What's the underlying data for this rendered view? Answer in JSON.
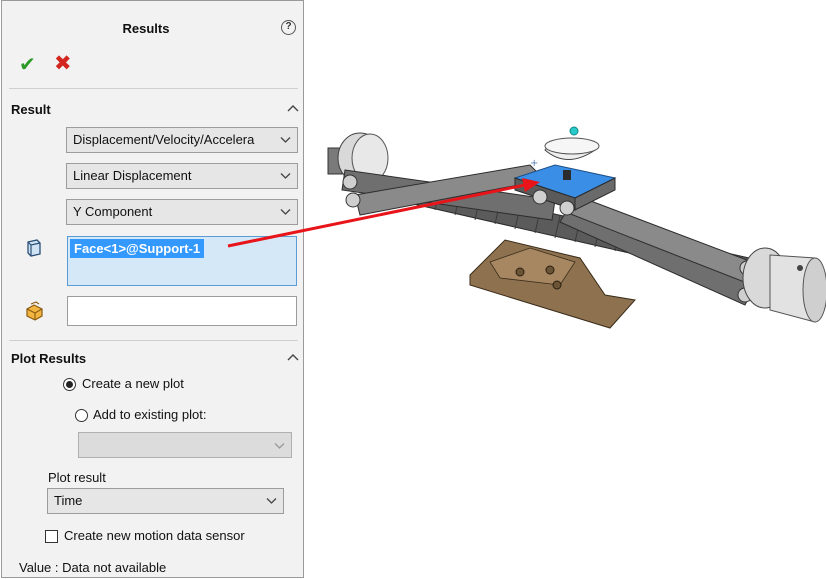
{
  "panel": {
    "title": "Results",
    "help_icon": "help-icon",
    "ok_icon": "checkmark-icon",
    "cancel_icon": "close-icon",
    "ok_symbol": "✔",
    "cancel_symbol": "✖",
    "help_symbol": "?"
  },
  "result_section": {
    "title": "Result",
    "category": "Displacement/Velocity/Accelera",
    "subcategory": "Linear Displacement",
    "component": "Y Component",
    "selection_item": "Face<1>@Support-1",
    "secondary_value": ""
  },
  "plot_section": {
    "title": "Plot Results",
    "option_new": "Create a new plot",
    "option_existing": "Add to existing plot:",
    "selected_option": "new",
    "existing_plot_value": "",
    "plot_result_label": "Plot result",
    "plot_result_value": "Time",
    "sensor_label": "Create new motion data sensor",
    "sensor_checked": false,
    "value_text": "Value : Data not available"
  },
  "colors": {
    "accent_selection": "#3399ff",
    "pointer_arrow": "#e8141a",
    "ok": "#2c9a28",
    "cancel": "#d2261e"
  }
}
